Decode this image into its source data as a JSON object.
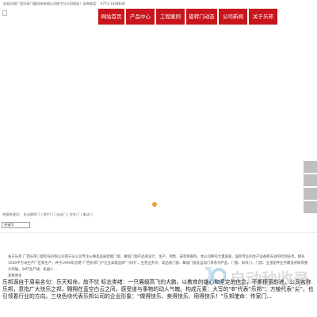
{
  "topbar": {
    "welcome": "欢迎光临广西乐邦门窗科技有限公司南宁分公司网站！咨询电话：",
    "phone": "0771-3348838"
  },
  "nav": {
    "items": [
      {
        "label": "网站首页"
      },
      {
        "label": "产品中心"
      },
      {
        "label": "工程案例"
      },
      {
        "label": "旋转门动态"
      },
      {
        "label": "公司新闻"
      },
      {
        "label": "关于乐邦"
      }
    ]
  },
  "hotwords": "热搜关键词：  自动旋转门 | 南宁门 | 自动门 | 红外门 | 电动门",
  "search": {
    "value": "关键字"
  },
  "about": {
    "text": "关于乐邦 广西乐邦门窗科技有限公司南宁分公司专注从事高品质智能门窗、幕墙门窗产品的设计、生产、销售、安装和服务。本公司拥有大量国家、国际专业的生产设备和先进的检测技术。拥有1000平方米生产厂区和生产，并于1999年创建“广西乐邦门户企业高级品牌”“乐邦”，主营业务为：高品质门窗、幕墙门窗及自动门等系列产品、门窗、屏风门、门禁、五金配件业务覆盖并取得重大突破。SMT生产线、机器人...",
    "more": "查看更多"
  },
  "brand": {
    "text": "乐邦源自于周易名句：乐天知命，故不忧 标志类绪：一只展翅高飞的大鹏，以教育的雄心和坚定的信念，不断探索前进。公司名称乐邦，意指广大快乐之邦，翱翔在蓝空白云之间，感受道与事物的动人气魄。构成元素：大写的“B”代表“乐邦”；方棱代表“尖”，也引领着行业的方向。三块色块代表乐邦公司的企业形象：“做得快乐、卖得快乐、用得快乐！”乐邦使命：传家门..."
  },
  "watermark": {
    "text": "自动秒收录",
    "sub": "ZIDONGMIAOSHOULU.COM"
  },
  "colors": {
    "nav": "#c8161d",
    "dot": "#e8a23a",
    "sidebtn": "#bfbfbf"
  }
}
